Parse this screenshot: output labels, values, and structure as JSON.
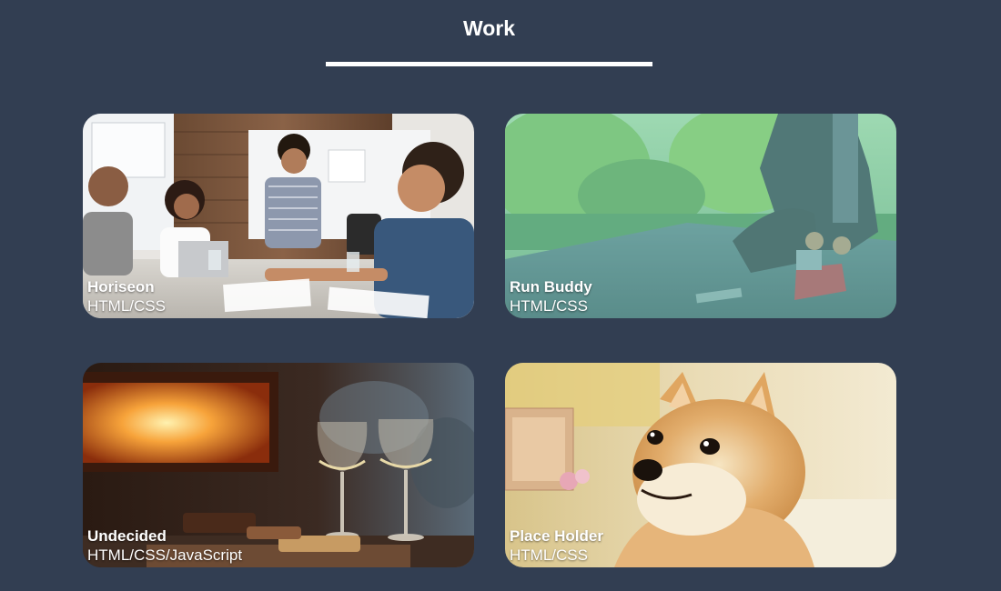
{
  "section": {
    "title": "Work"
  },
  "projects": [
    {
      "name": "Horiseon",
      "tech": "HTML/CSS",
      "image": "office-meeting-photo"
    },
    {
      "name": "Run Buddy",
      "tech": "HTML/CSS",
      "image": "runner-tying-shoe-photo"
    },
    {
      "name": "Undecided",
      "tech": "HTML/CSS/JavaScript",
      "image": "wine-glasses-fireplace-photo"
    },
    {
      "name": "Place Holder",
      "tech": "HTML/CSS",
      "image": "shiba-dog-photo"
    }
  ],
  "colors": {
    "background": "#323e52",
    "text": "#ffffff",
    "run_buddy_overlay": "#7fd1c8"
  }
}
